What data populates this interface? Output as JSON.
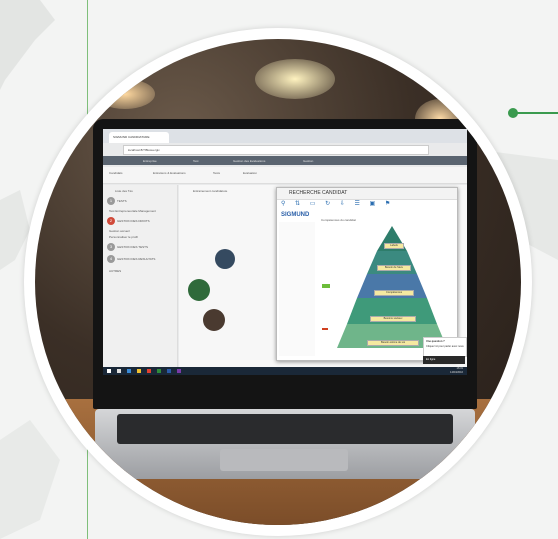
{
  "browser": {
    "tab_title": "SIGMUND CANDIDATURE",
    "address": "localhost:8/?/Biosuergix"
  },
  "app_nav": [
    "Entreprise",
    "Test",
    "Gestion des Evaluations",
    "Gestion"
  ],
  "toolbar_items": [
    "Candidats",
    "Entretiens & Evaluations",
    "Tests",
    "Evaluation"
  ],
  "sidebar": {
    "header": "Liste des Tés",
    "items": [
      {
        "num": "1",
        "label": "TESTS"
      },
      {
        "num": "",
        "label": "Test Entrepreneuriale Management"
      },
      {
        "num": "2",
        "label": "GESTION DES DROITS"
      },
      {
        "num": "",
        "label": "Gestion accueil"
      },
      {
        "num": "",
        "label": "Personnaliser le profil"
      },
      {
        "num": "3",
        "label": "GESTION DES TESTS"
      },
      {
        "num": "4",
        "label": "GESTION DES RESULTATS"
      },
      {
        "num": "",
        "label": "AUTRES"
      }
    ]
  },
  "bg_header": "Entrainement candidature",
  "dialog": {
    "title": "RECHERCHE CANDIDAT",
    "logo": "SIGMUND",
    "subtitle": "Compétences du candidat",
    "pyramid_labels": [
      "Labels",
      "Besoin de Sécu",
      "Compétences",
      "Besoins sociaux",
      "Besoin estime de soi"
    ]
  },
  "notification": {
    "title": "Une question ?",
    "body": "Cliquez ici pour parler avec nous",
    "bar": "En ligne"
  },
  "clock": {
    "time": "16:31",
    "date": "14/03/2016"
  },
  "colors": {
    "accent_green": "#3a9a4e",
    "pyramid": [
      "#2e7d6b",
      "#3b8a80",
      "#4a78a8",
      "#3f9a7a",
      "#6fb58a"
    ]
  }
}
